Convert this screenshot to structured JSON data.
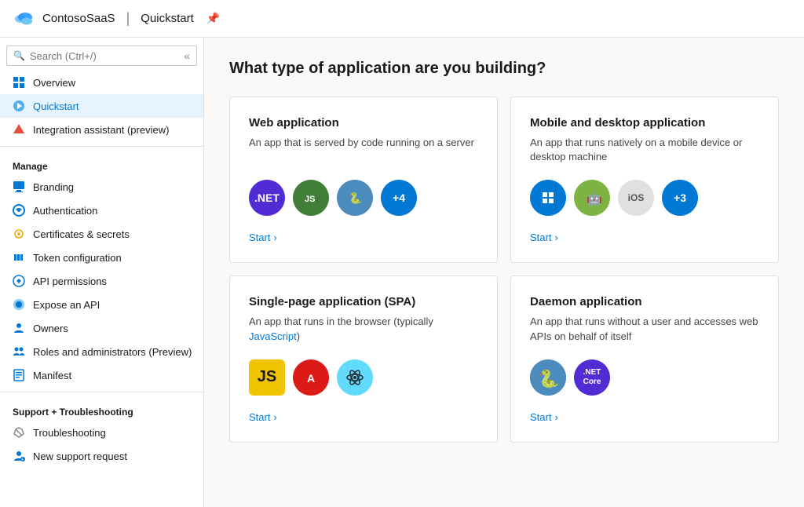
{
  "topbar": {
    "logo_alt": "Azure logo",
    "app_name": "ContosoSaaS",
    "separator": "|",
    "page_name": "Quickstart",
    "pin_icon": "📌"
  },
  "sidebar": {
    "search_placeholder": "Search (Ctrl+/)",
    "collapse_icon": "«",
    "items": [
      {
        "id": "overview",
        "label": "Overview",
        "icon": "grid",
        "active": false
      },
      {
        "id": "quickstart",
        "label": "Quickstart",
        "icon": "rocket",
        "active": true
      },
      {
        "id": "integration",
        "label": "Integration assistant (preview)",
        "icon": "rocket2",
        "active": false
      }
    ],
    "manage_label": "Manage",
    "manage_items": [
      {
        "id": "branding",
        "label": "Branding",
        "icon": "branding"
      },
      {
        "id": "authentication",
        "label": "Authentication",
        "icon": "auth"
      },
      {
        "id": "certificates",
        "label": "Certificates & secrets",
        "icon": "cert"
      },
      {
        "id": "token",
        "label": "Token configuration",
        "icon": "token"
      },
      {
        "id": "api-permissions",
        "label": "API permissions",
        "icon": "api"
      },
      {
        "id": "expose-api",
        "label": "Expose an API",
        "icon": "expose"
      },
      {
        "id": "owners",
        "label": "Owners",
        "icon": "owners"
      },
      {
        "id": "roles",
        "label": "Roles and administrators (Preview)",
        "icon": "roles"
      },
      {
        "id": "manifest",
        "label": "Manifest",
        "icon": "manifest"
      }
    ],
    "support_label": "Support + Troubleshooting",
    "support_items": [
      {
        "id": "troubleshooting",
        "label": "Troubleshooting",
        "icon": "trouble"
      },
      {
        "id": "new-support",
        "label": "New support request",
        "icon": "support"
      }
    ]
  },
  "main": {
    "title": "What type of application are you building?",
    "cards": [
      {
        "id": "web-app",
        "title": "Web application",
        "desc": "An app that is served by code running on a server",
        "start_label": "Start",
        "icons": [
          {
            "type": "dotnet",
            "label": ".NET"
          },
          {
            "type": "node",
            "label": "Node"
          },
          {
            "type": "python",
            "label": "Python"
          },
          {
            "type": "plus",
            "label": "+4"
          }
        ]
      },
      {
        "id": "mobile-desktop",
        "title": "Mobile and desktop application",
        "desc": "An app that runs natively on a mobile device or desktop machine",
        "start_label": "Start",
        "icons": [
          {
            "type": "windows",
            "label": "Windows"
          },
          {
            "type": "android",
            "label": "Android"
          },
          {
            "type": "ios",
            "label": "iOS"
          },
          {
            "type": "plus3",
            "label": "+3"
          }
        ]
      },
      {
        "id": "spa",
        "title": "Single-page application (SPA)",
        "desc_plain": "An app that runs in the browser (typically ",
        "desc_link": "JavaScript",
        "desc_end": ")",
        "start_label": "Start",
        "icons": [
          {
            "type": "js",
            "label": "JS"
          },
          {
            "type": "angular",
            "label": "Angular"
          },
          {
            "type": "react",
            "label": "React"
          }
        ]
      },
      {
        "id": "daemon",
        "title": "Daemon application",
        "desc": "An app that runs without a user and accesses web APIs on behalf of itself",
        "start_label": "Start",
        "icons": [
          {
            "type": "pycore",
            "label": "Python"
          },
          {
            "type": "netcore",
            "label": ".NET Core"
          }
        ]
      }
    ]
  }
}
